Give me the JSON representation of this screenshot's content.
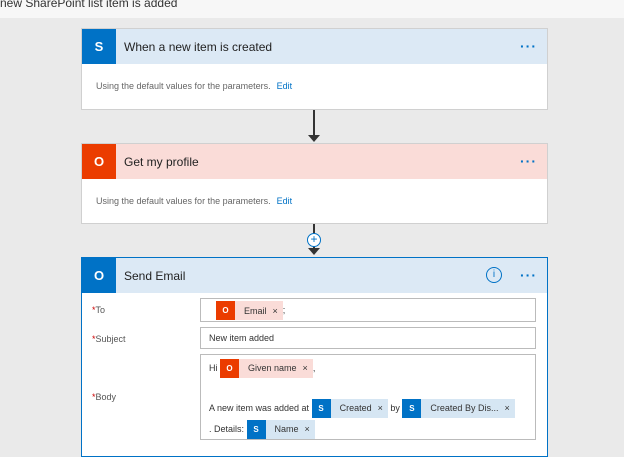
{
  "header": {
    "title": "new SharePoint list item is added"
  },
  "steps": [
    {
      "title": "When a new item is created",
      "description": "Using the default values for the parameters.",
      "edit": "Edit",
      "icon": "sharepoint-icon",
      "icon_text": "S",
      "color": "#0072c6",
      "header_bg": "#dce9f5",
      "menu": "···"
    },
    {
      "title": "Get my profile",
      "description": "Using the default values for the parameters.",
      "edit": "Edit",
      "icon": "office365-icon",
      "icon_text": "O",
      "color": "#eb3c00",
      "header_bg": "#fadcd8",
      "menu": "···"
    },
    {
      "title": "Send Email",
      "icon": "outlook-icon",
      "icon_text": "O",
      "color": "#0072c6",
      "header_bg": "#dce9f5",
      "menu": "···",
      "info": "i"
    }
  ],
  "add_step": "+",
  "email": {
    "to": {
      "label": "To",
      "required": "*",
      "token": "Email",
      "suffix": ";",
      "remove": "×"
    },
    "subject": {
      "label": "Subject",
      "required": "*",
      "value": "New item added"
    },
    "body": {
      "label": "Body",
      "required": "*",
      "greeting": "Hi",
      "given_name": "Given name",
      "comma": ",",
      "line2": "A new item was added at",
      "created": "Created",
      "by": "by",
      "created_by": "Created By Dis...",
      "details": ". Details:",
      "name": "Name",
      "remove": "×"
    }
  }
}
